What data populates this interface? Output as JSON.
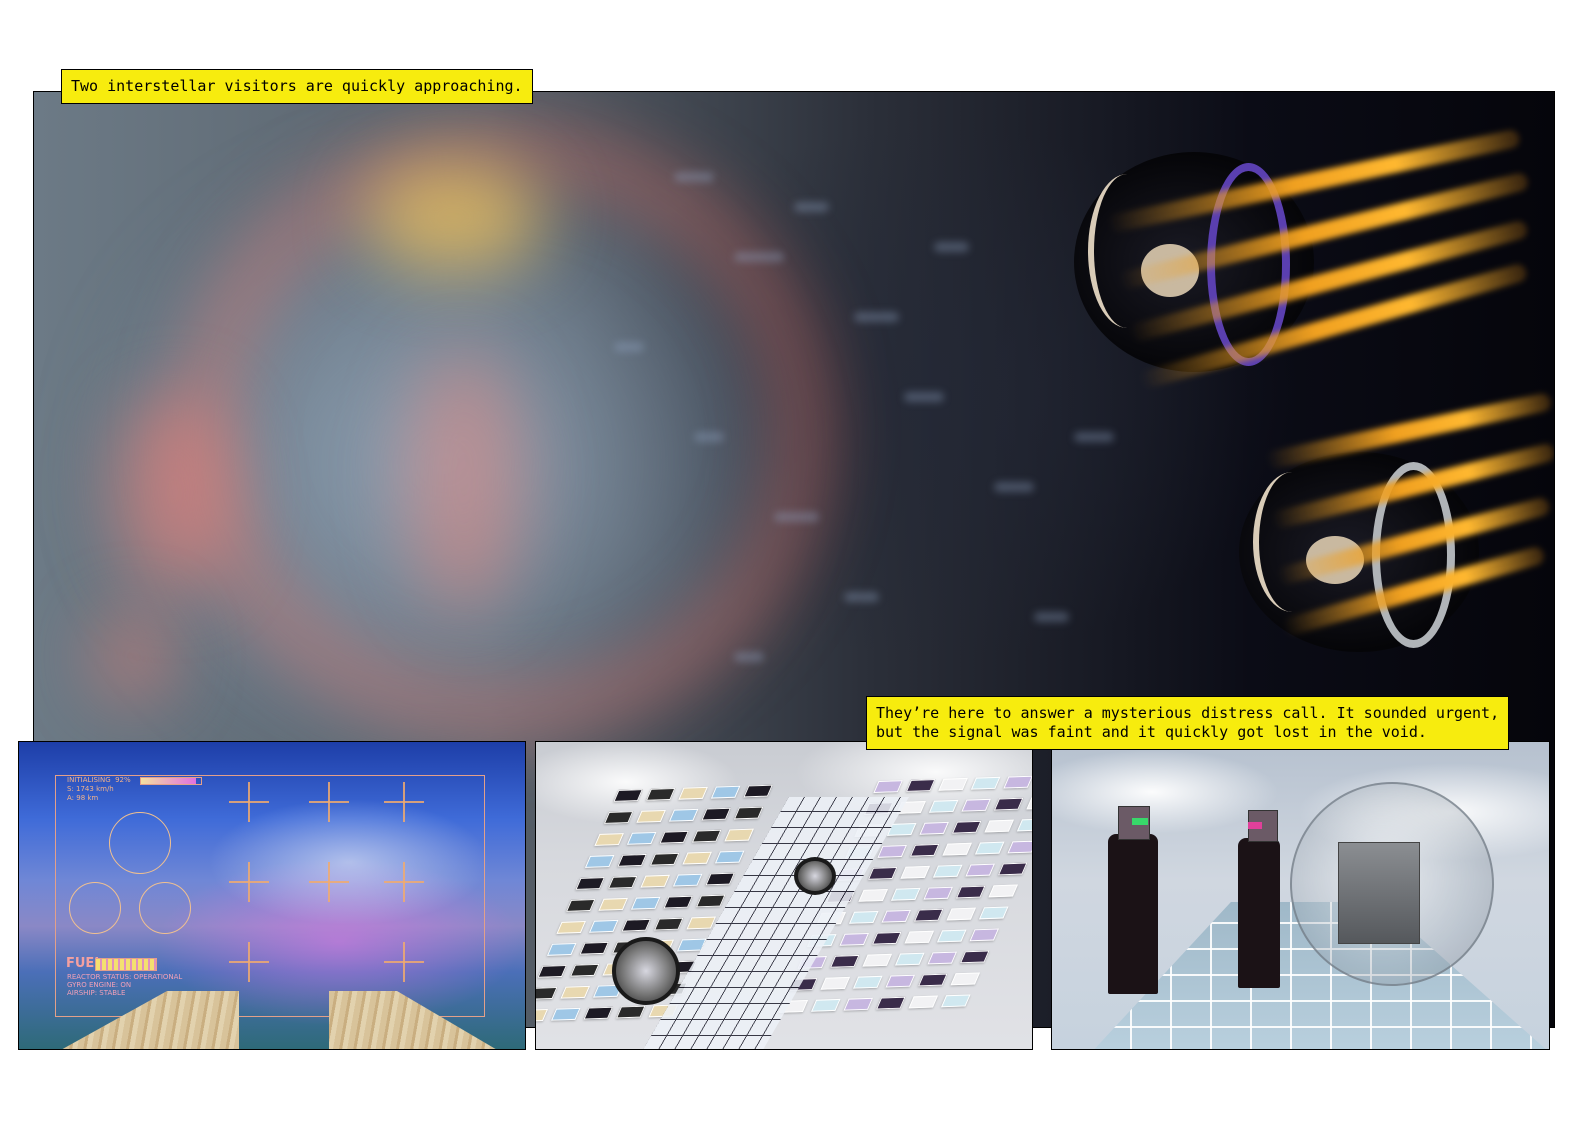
{
  "captions": {
    "top": "Two interstellar visitors are quickly approaching.",
    "middle": "They’re here to answer a mysterious distress call. It sounded urgent,\nbut the signal was faint and it quickly got lost in the void."
  },
  "hud": {
    "initialising": "INITIALISING  92%",
    "speed": "S: 1743 km/h",
    "altitude": "A: 98 km",
    "fuel_label": "FUEL",
    "reactor_status": "REACTOR STATUS: OPERATIONAL",
    "gyro_engine": "GYRO ENGINE: ON",
    "airship": "AIRSHIP: STABLE",
    "progress_fraction": 0.92
  },
  "colors": {
    "caption_bg": "#f7ec0e",
    "flame": "#f0a020",
    "hud": "#f0b28c"
  }
}
